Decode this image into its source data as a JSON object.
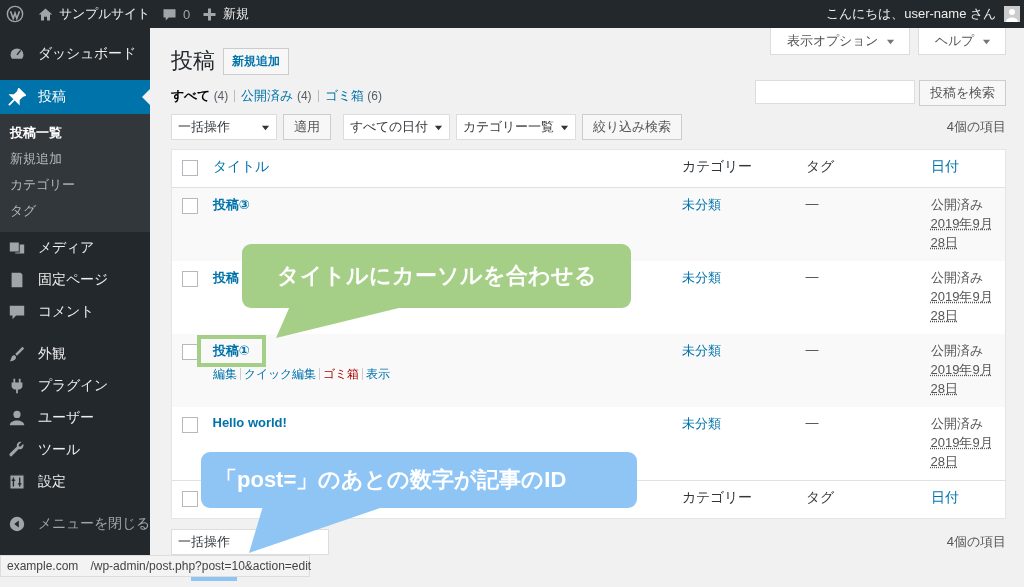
{
  "admin_bar": {
    "site_name": "サンプルサイト",
    "comments_count": "0",
    "new_label": "新規",
    "greeting": "こんにちは、user-name さん"
  },
  "sidebar": {
    "groups": [
      [
        {
          "label": "ダッシュボード",
          "selected": false
        }
      ],
      [
        {
          "label": "投稿",
          "selected": true,
          "children": [
            {
              "label": "投稿一覧",
              "selected": true
            },
            {
              "label": "新規追加",
              "selected": false
            },
            {
              "label": "カテゴリー",
              "selected": false
            },
            {
              "label": "タグ",
              "selected": false
            }
          ]
        },
        {
          "label": "メディア",
          "selected": false
        },
        {
          "label": "固定ページ",
          "selected": false
        },
        {
          "label": "コメント",
          "selected": false
        }
      ],
      [
        {
          "label": "外観",
          "selected": false
        },
        {
          "label": "プラグイン",
          "selected": false
        },
        {
          "label": "ユーザー",
          "selected": false
        },
        {
          "label": "ツール",
          "selected": false
        },
        {
          "label": "設定",
          "selected": false
        }
      ]
    ],
    "collapse_label": "メニューを閉じる"
  },
  "screen_tabs": [
    {
      "label": "表示オプション"
    },
    {
      "label": "ヘルプ"
    }
  ],
  "page": {
    "title": "投稿",
    "add_new": "新規追加"
  },
  "filters": [
    {
      "label": "すべて",
      "count": "(4)",
      "selected": true
    },
    {
      "label": "公開済み",
      "count": "(4)",
      "selected": false
    },
    {
      "label": "ゴミ箱",
      "count": "(6)",
      "selected": false
    }
  ],
  "search": {
    "button": "投稿を検索"
  },
  "tablenav_top": {
    "bulk": "一括操作",
    "apply": "適用",
    "dates": "すべての日付",
    "categories": "カテゴリー一覧",
    "filter": "絞り込み検索",
    "count": "4個の項目"
  },
  "table": {
    "select_all_checked": false,
    "columns": [
      {
        "label": "タイトル",
        "sortable": true
      },
      {
        "label": "カテゴリー",
        "sortable": false
      },
      {
        "label": "タグ",
        "sortable": false
      },
      {
        "label": "日付",
        "sortable": true
      }
    ],
    "rows": [
      {
        "title": "投稿③",
        "checked": false,
        "highlighted": false,
        "category": "未分類",
        "tags": "—",
        "status": "公開済み",
        "date": "2019年9月28日"
      },
      {
        "title": "投稿",
        "checked": false,
        "highlighted": false,
        "category": "未分類",
        "tags": "—",
        "status": "公開済み",
        "date": "2019年9月28日"
      },
      {
        "title": "投稿①",
        "checked": false,
        "highlighted": true,
        "category": "未分類",
        "tags": "—",
        "status": "公開済み",
        "date": "2019年9月28日",
        "row_actions": [
          {
            "label": "編集",
            "kind": "normal"
          },
          {
            "label": "クイック編集",
            "kind": "normal"
          },
          {
            "label": "ゴミ箱",
            "kind": "trash"
          },
          {
            "label": "表示",
            "kind": "normal"
          }
        ]
      },
      {
        "title": "Hello world!",
        "checked": false,
        "highlighted": false,
        "category": "未分類",
        "tags": "—",
        "status": "公開済み",
        "date": "2019年9月28日"
      }
    ],
    "footer_select_all_checked": false,
    "footer_columns": [
      {
        "label": "カテゴリー",
        "sortable": false
      },
      {
        "label": "タグ",
        "sortable": false
      },
      {
        "label": "日付",
        "sortable": true
      }
    ]
  },
  "tablenav_bottom": {
    "bulk": "一括操作",
    "count": "4個の項目"
  },
  "callouts": [
    {
      "text": "タイトルにカーソルを合わせる",
      "color": "#a5cf86"
    },
    {
      "text": "「post=」のあとの数字が記事のID",
      "color": "#8fc5f5"
    }
  ],
  "status_bar": {
    "host": "example.com",
    "path": "/wp-admin/post.php?post=10&action=edit"
  }
}
